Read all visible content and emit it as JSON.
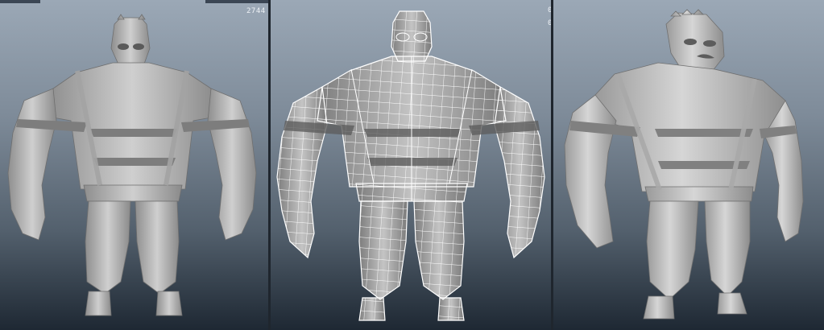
{
  "viewports": {
    "left": {
      "poly_count": "2744"
    },
    "middle": {
      "stat_1": "0",
      "stat_2": "0"
    },
    "right": {}
  },
  "colors": {
    "bg_top": "#9ba8b6",
    "bg_bottom": "#1e2833",
    "model_gray": "#b8b8b8",
    "wireframe": "#ffffff"
  }
}
